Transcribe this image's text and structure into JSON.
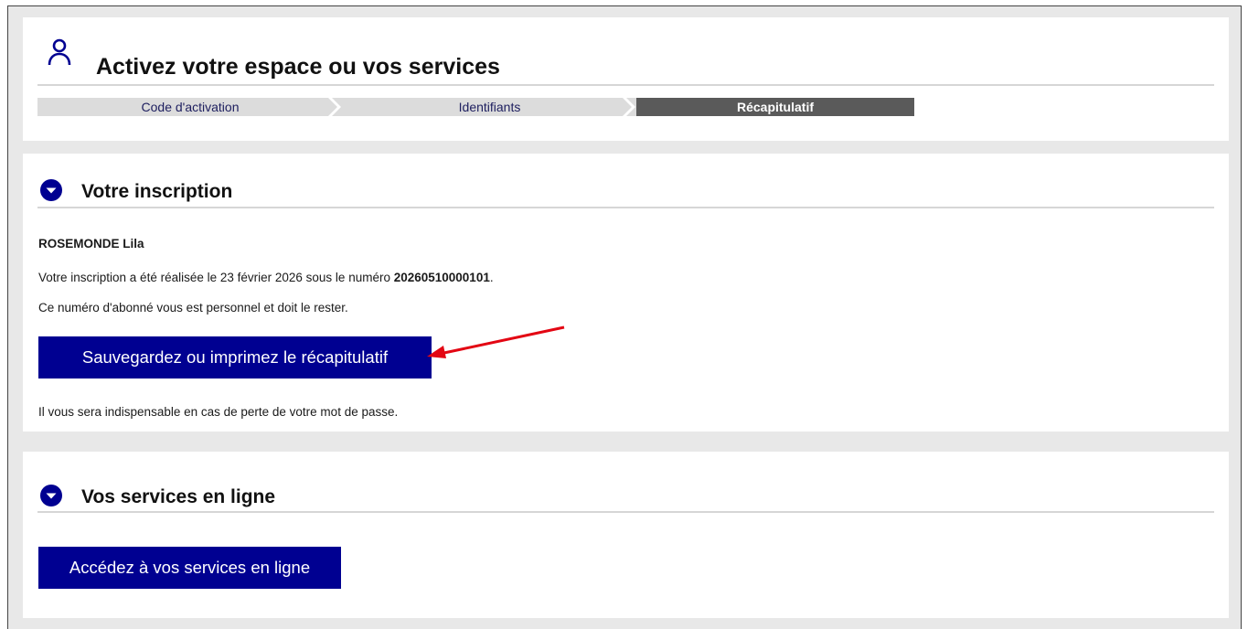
{
  "header": {
    "title": "Activez votre espace ou vos services",
    "steps": [
      {
        "label": "Code d'activation",
        "state": "done"
      },
      {
        "label": "Identifiants",
        "state": "done"
      },
      {
        "label": "Récapitulatif",
        "state": "current"
      }
    ]
  },
  "inscription": {
    "section_title": "Votre inscription",
    "name": "ROSEMONDE Lila",
    "line1_prefix": "Votre inscription a été réalisée le 23 février 2026 sous le numéro ",
    "line1_number": "20260510000101",
    "line1_suffix": ".",
    "line2": "Ce numéro d'abonné vous est personnel et doit le rester.",
    "save_button": "Sauvegardez ou imprimez le récapitulatif",
    "line4": "Il vous sera indispensable en cas de perte de votre mot de passe."
  },
  "services": {
    "section_title": "Vos services en ligne",
    "button": "Accédez à vos services en ligne"
  },
  "colors": {
    "primary": "#000091",
    "step_done_bg": "#dcdcdc",
    "step_current_bg": "#5a5a5a",
    "annotation_arrow": "#e30613",
    "page_bg": "#e8e8e8"
  },
  "icons": {
    "header": "user-outline-icon",
    "section": "chevron-down-circle-icon",
    "annotation": "red-arrow-icon"
  }
}
